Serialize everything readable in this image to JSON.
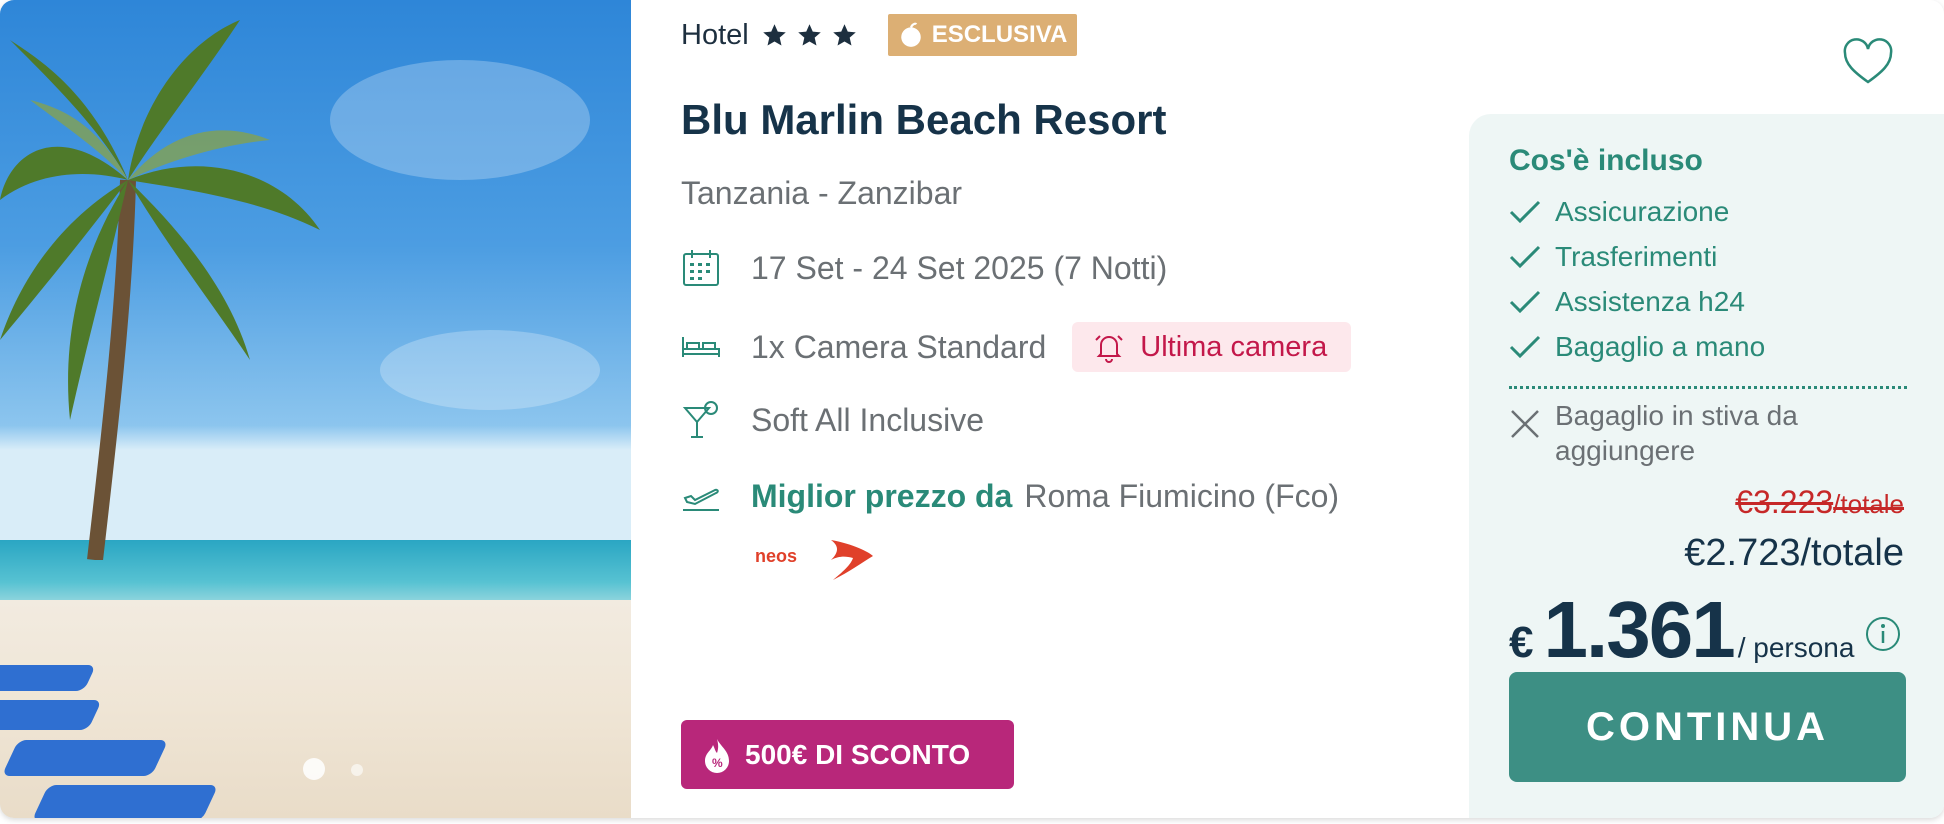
{
  "hotel": {
    "type_label": "Hotel",
    "stars": 3,
    "exclusive_badge": "ESCLUSIVA",
    "name": "Blu Marlin Beach Resort",
    "location": "Tanzania - Zanzibar"
  },
  "details": {
    "dates": "17 Set - 24 Set 2025 (7 Notti)",
    "room": "1x Camera Standard",
    "last_room_badge": "Ultima camera",
    "board": "Soft All Inclusive",
    "best_price_label": "Miglior prezzo da",
    "departure": "Roma Fiumicino (Fco)"
  },
  "airline": {
    "logo_text": "neos",
    "color": "#e0402a"
  },
  "promo": {
    "discount_label": "500€ DI SCONTO",
    "color": "#b8277a"
  },
  "gallery": {
    "slides": 2,
    "active_slide": 1
  },
  "included": {
    "title": "Cos'è incluso",
    "items": [
      "Assicurazione",
      "Trasferimenti",
      "Assistenza h24",
      "Bagaglio a mano"
    ],
    "excluded_line1": "Bagaglio in stiva da",
    "excluded_line2": "aggiungere"
  },
  "pricing": {
    "old_total": "€3.223",
    "old_total_unit": "/totale",
    "total": "€2.723/totale",
    "currency": "€",
    "per_person": "1.361",
    "per_person_unit": "/ persona",
    "cta_label": "CONTINUA"
  },
  "colors": {
    "accent_teal": "#2a8a78",
    "cta": "#3d8f84",
    "title": "#163349",
    "exclusive": "#dcaf74",
    "alert": "#c3184a",
    "strike_price": "#c62828"
  }
}
